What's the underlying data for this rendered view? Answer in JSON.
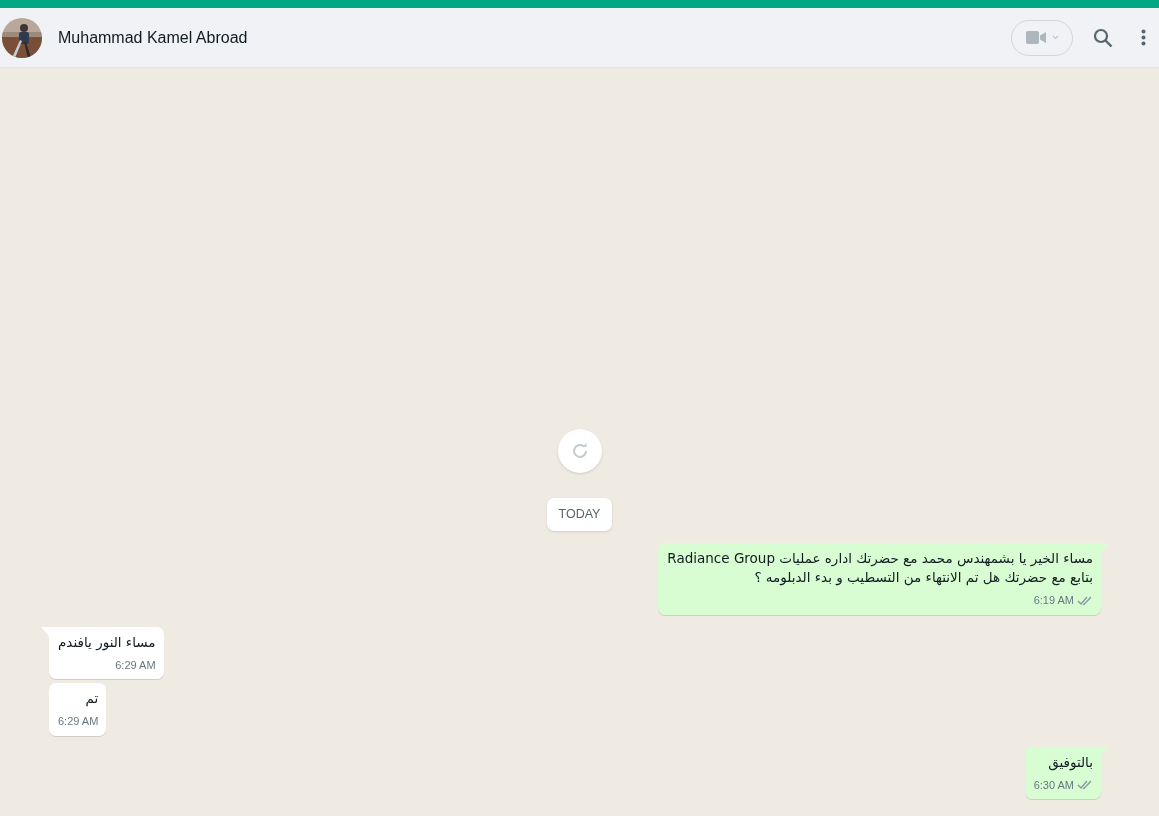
{
  "header": {
    "contact_name": "Muhammad Kamel Abroad"
  },
  "chat": {
    "refresh": {
      "kind": "button"
    },
    "date_divider": "TODAY",
    "messages": [
      {
        "outgoing": true,
        "tail": true,
        "text": "مساء الخير يا بشمهندس محمد  مع  حضرتك اداره عمليات Radiance Group\nبتابع مع حضرتك هل تم الانتهاء من التسطيب و بدء الدبلومه ؟",
        "time": "6:19 AM",
        "read": false
      },
      {
        "outgoing": false,
        "tail": true,
        "text": "مساء النور يافندم",
        "time": "6:29 AM"
      },
      {
        "outgoing": false,
        "tail": false,
        "text": "تم",
        "time": "6:29 AM"
      },
      {
        "outgoing": true,
        "tail": true,
        "text": "بالتوفيق",
        "time": "6:30 AM",
        "read": false
      }
    ]
  }
}
